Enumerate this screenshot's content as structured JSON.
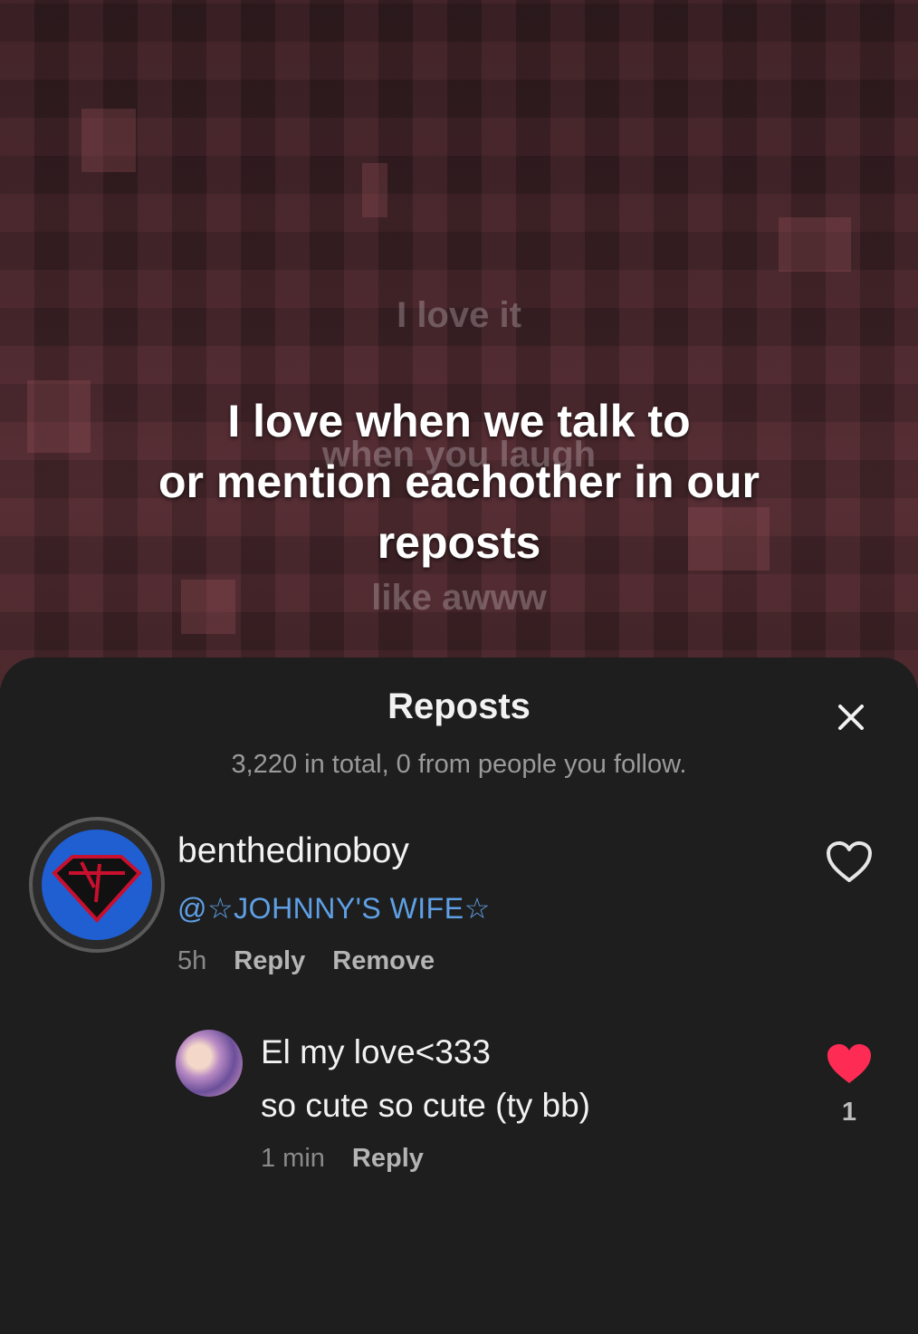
{
  "video": {
    "ghost_lines": [
      "I love it",
      "when you laugh",
      "like awww"
    ],
    "caption_lines": [
      "I love when we talk to",
      "or mention eachother in our",
      "reposts"
    ]
  },
  "sheet": {
    "title": "Reposts",
    "subtitle": "3,220 in total, 0 from people you follow."
  },
  "comments": [
    {
      "username": "benthedinoboy",
      "text": "@☆JOHNNY'S WIFE☆",
      "time": "5h",
      "actions": [
        "Reply",
        "Remove"
      ],
      "liked": false
    },
    {
      "username": "El my love<333",
      "text": "so cute so cute (ty bb)",
      "time": "1 min",
      "actions": [
        "Reply"
      ],
      "liked": true,
      "like_count": "1"
    }
  ],
  "colors": {
    "background": "#1e1e1e",
    "mention": "#5ea0e6",
    "like": "#fe2c55"
  }
}
